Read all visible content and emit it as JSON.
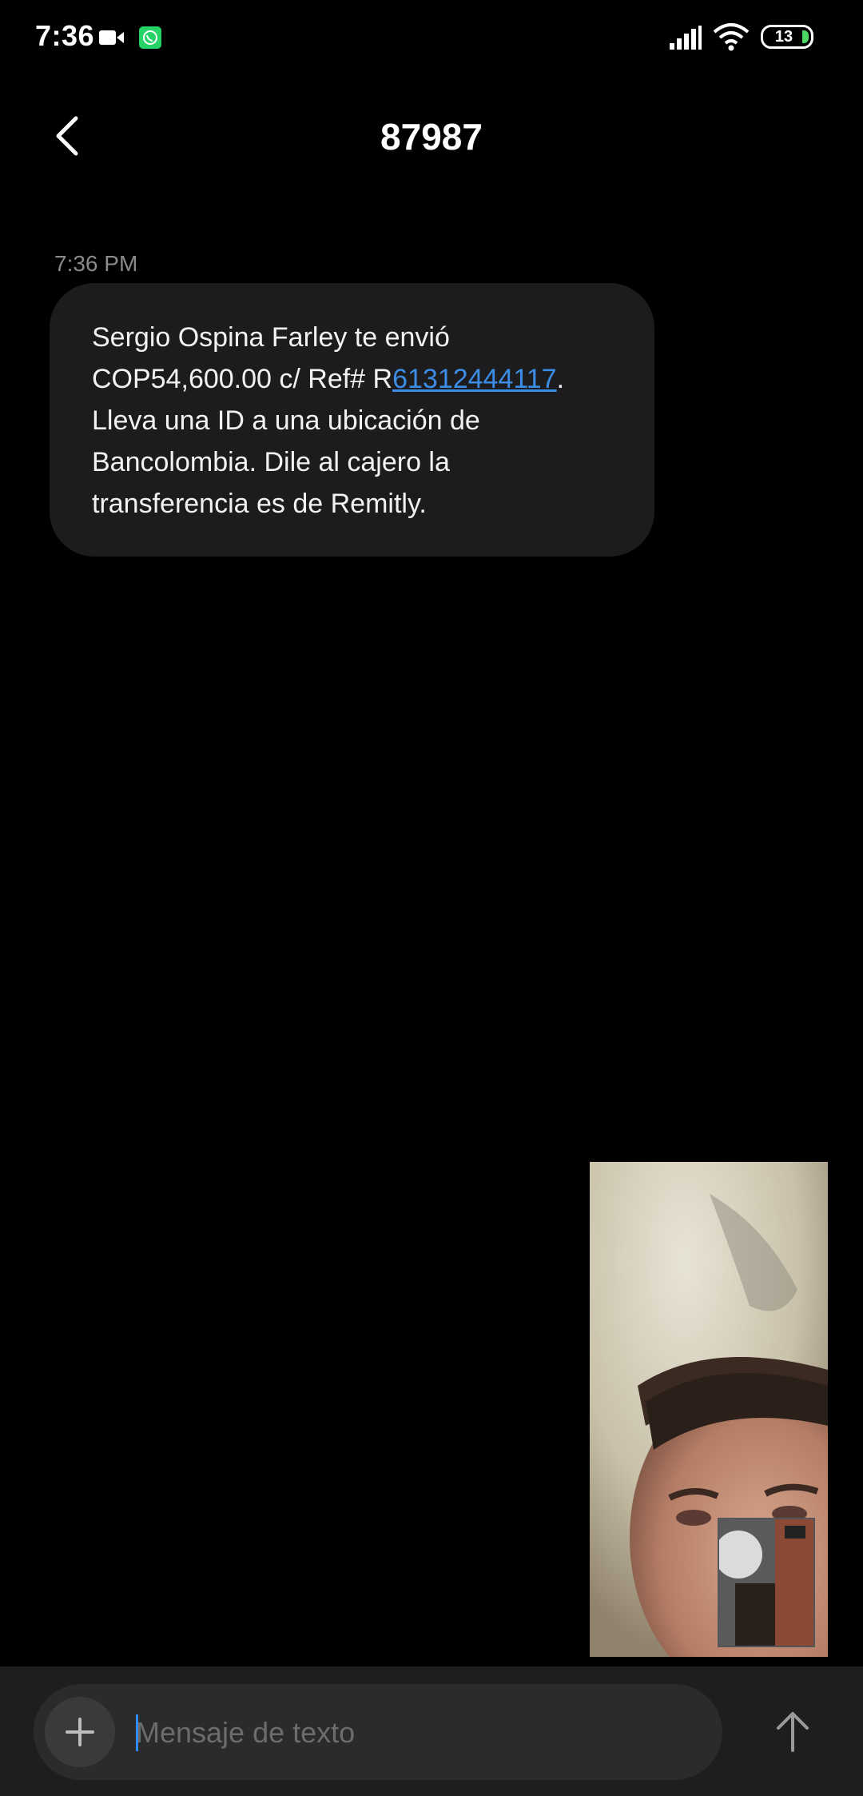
{
  "status_bar": {
    "time": "7:36",
    "battery_level": "13",
    "icons": [
      "video-icon",
      "whatsapp-icon",
      "signal-icon",
      "wifi-icon",
      "battery-icon"
    ]
  },
  "header": {
    "title": "87987",
    "back_icon": "back-arrow-icon"
  },
  "messages": [
    {
      "time": "7:36 PM",
      "text_before_link": "Sergio Ospina Farley te envió COP54,600.00 c/ Ref# R",
      "link": "61312444117",
      "text_after_link": ". Lleva una ID a una ubicación de Bancolombia. Dile al cajero la transferencia es de Remitly."
    }
  ],
  "compose": {
    "placeholder": "Mensaje de texto",
    "add_icon": "plus-icon",
    "send_icon": "send-arrow-icon"
  },
  "colors": {
    "background": "#000000",
    "bubble": "#1c1c1e",
    "link": "#3b8de6",
    "compose_bar": "#1e1e1e",
    "caret": "#2f8cff"
  }
}
